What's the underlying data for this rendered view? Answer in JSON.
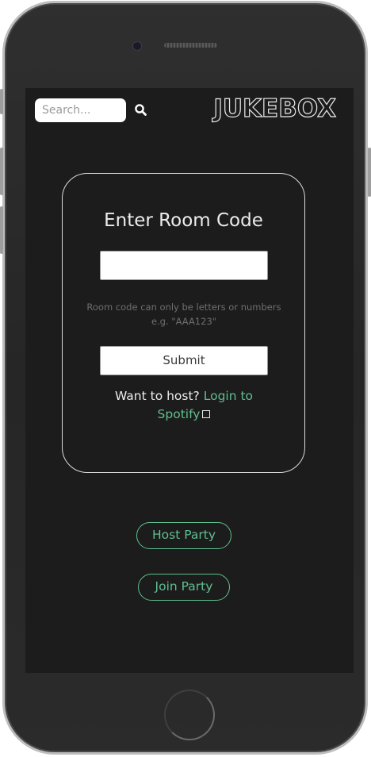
{
  "header": {
    "search": {
      "placeholder": "Search...",
      "value": ""
    },
    "search_icon": "magnifier-icon",
    "logo_text": "JUKEBOX"
  },
  "room_card": {
    "title": "Enter Room Code",
    "code_input": {
      "value": "",
      "placeholder": ""
    },
    "hint": "Room code can only be letters or numbers e.g. \"AAA123\"",
    "submit_label": "Submit",
    "host_prompt": "Want to host?",
    "login_link": "Login to Spotify",
    "external_icon": "external-link-icon"
  },
  "actions": {
    "host_party": "Host Party",
    "join_party": "Join Party"
  },
  "colors": {
    "accent": "#5fbf8f",
    "screen_bg": "#1c1c1c",
    "card_border": "#dcdcdc",
    "text": "#ececec",
    "hint_text": "#6e6e6e"
  }
}
